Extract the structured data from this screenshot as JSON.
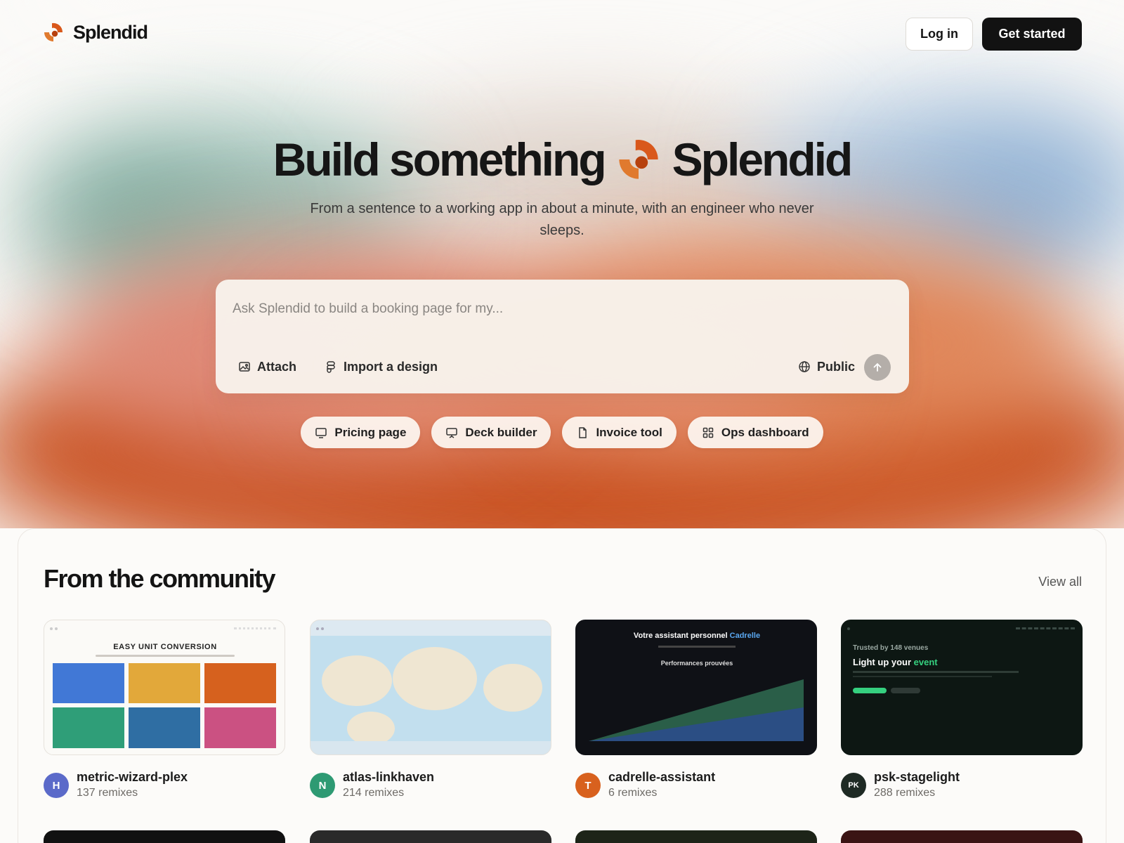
{
  "brand": {
    "name": "Splendid"
  },
  "nav": {
    "login_label": "Log in",
    "start_label": "Get started"
  },
  "hero": {
    "title_left": "Build something",
    "title_right": "Splendid",
    "subtitle": "From a sentence to a working app in about a minute, with an engineer who never sleeps."
  },
  "prompt": {
    "placeholder": "Ask Splendid to build a booking page for my...",
    "attach_label": "Attach",
    "import_label": "Import a design",
    "visibility_label": "Public"
  },
  "chips": [
    {
      "label": "Pricing page",
      "icon": "monitor-icon"
    },
    {
      "label": "Deck builder",
      "icon": "presentation-icon"
    },
    {
      "label": "Invoice tool",
      "icon": "document-icon"
    },
    {
      "label": "Ops dashboard",
      "icon": "grid-icon"
    }
  ],
  "community": {
    "title": "From the community",
    "view_all": "View all",
    "cards": [
      {
        "name": "metric-wizard-plex",
        "remixes": "137 remixes",
        "avatar": "H",
        "avatar_color": "#5b6ac9",
        "thumb_text": "EASY UNIT CONVERSION"
      },
      {
        "name": "atlas-linkhaven",
        "remixes": "214 remixes",
        "avatar": "N",
        "avatar_color": "#2e9a73"
      },
      {
        "name": "cadrelle-assistant",
        "remixes": "6 remixes",
        "avatar": "T",
        "avatar_color": "#d8611e",
        "thumb_text": "Votre assistant personnel",
        "thumb_accent": "Cadrelle",
        "thumb_sub": "Performances prouvées"
      },
      {
        "name": "psk-stagelight",
        "remixes": "288 remixes",
        "avatar": "PK",
        "avatar_color": "#1e2a24",
        "thumb_small": "Trusted by 148 venues",
        "thumb_text": "Light up your",
        "thumb_accent": "event"
      }
    ]
  },
  "colors": {
    "accent_orange": "#d9581b",
    "dark_button": "#121212",
    "tile_blue": "#4178d6",
    "tile_amber": "#e2a83a",
    "tile_orange": "#d6611e",
    "tile_green": "#2f9e78",
    "tile_steel": "#2f6ea3",
    "tile_pink": "#cb5182",
    "neon_green": "#35d07f",
    "link_blue": "#5aa7f0"
  }
}
